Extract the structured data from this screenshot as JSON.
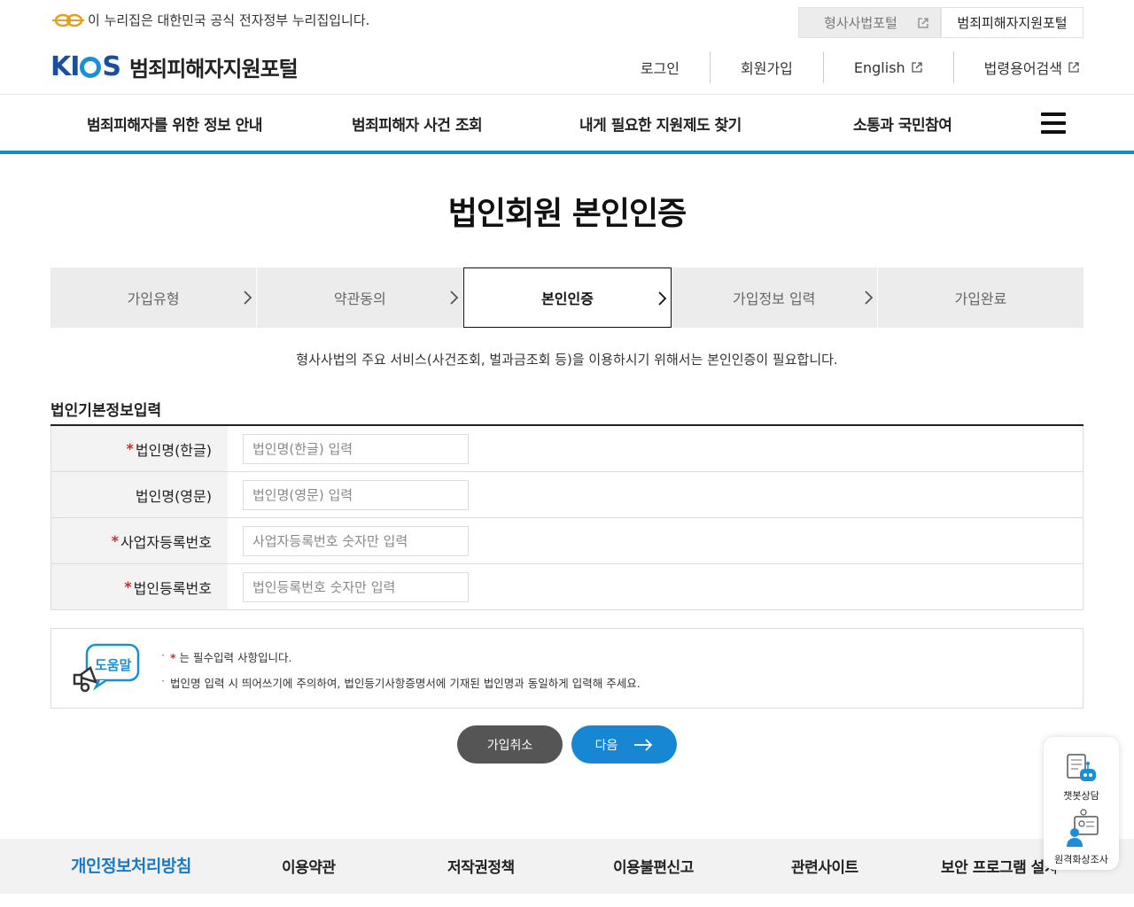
{
  "gov_bar": {
    "text": "이 누리집은 대한민국 공식 전자정부 누리집입니다."
  },
  "portal_links": [
    {
      "label": "형사사법포털"
    },
    {
      "label": "범죄피해자지원포털"
    }
  ],
  "header": {
    "logo_text": "KICS",
    "site_name": "범죄피해자지원포털",
    "util_menu": [
      {
        "label": "로그인"
      },
      {
        "label": "회원가입"
      },
      {
        "label": "English"
      },
      {
        "label": "법령용어검색"
      }
    ]
  },
  "gnb": [
    {
      "label": "범죄피해자를 위한 정보 안내"
    },
    {
      "label": "범죄피해자 사건 조회"
    },
    {
      "label": "내게 필요한 지원제도 찾기"
    },
    {
      "label": "소통과 국민참여"
    }
  ],
  "page_title": "법인회원 본인인증",
  "steps": [
    {
      "label": "가입유형",
      "current": false
    },
    {
      "label": "약관동의",
      "current": false
    },
    {
      "label": "본인인증",
      "current": true
    },
    {
      "label": "가입정보 입력",
      "current": false
    },
    {
      "label": "가입완료",
      "current": false
    }
  ],
  "notice": "형사사법의 주요 서비스(사건조회, 벌과금조회 등)을 이용하시기 위해서는 본인인증이 필요합니다.",
  "section_title": "법인기본정보입력",
  "form": {
    "rows": [
      {
        "label": "법인명(한글)",
        "required": true,
        "placeholder": "법인명(한글) 입력",
        "value": ""
      },
      {
        "label": "법인명(영문)",
        "required": false,
        "placeholder": "법인명(영문) 입력",
        "value": ""
      },
      {
        "label": "사업자등록번호",
        "required": true,
        "placeholder": "사업자등록번호 숫자만 입력",
        "value": ""
      },
      {
        "label": "법인등록번호",
        "required": true,
        "placeholder": "법인등록번호 숫자만 입력",
        "value": ""
      }
    ],
    "required_mark": "*"
  },
  "help": {
    "label": "도움말",
    "items": [
      {
        "star": "*",
        "text": " 는 필수입력 사항입니다."
      },
      {
        "star": "",
        "text": "법인명 입력 시 띄어쓰기에 주의하여, 법인등기사항증명서에 기재된 법인명과 동일하게 입력해 주세요."
      }
    ]
  },
  "buttons": {
    "cancel": "가입취소",
    "next": "다음"
  },
  "footer": [
    {
      "label": "개인정보처리방침"
    },
    {
      "label": "이용약관"
    },
    {
      "label": "저작권정책"
    },
    {
      "label": "이용불편신고"
    },
    {
      "label": "관련사이트"
    },
    {
      "label": "보안 프로그램 설치"
    }
  ],
  "quick_menu": [
    {
      "label": "챗봇상담",
      "icon": "chatbot-icon"
    },
    {
      "label": "원격화상조사",
      "icon": "video-call-icon"
    }
  ],
  "colors": {
    "accent": "#1787d4",
    "required": "#d62828",
    "brand": "#1a4f9c"
  }
}
